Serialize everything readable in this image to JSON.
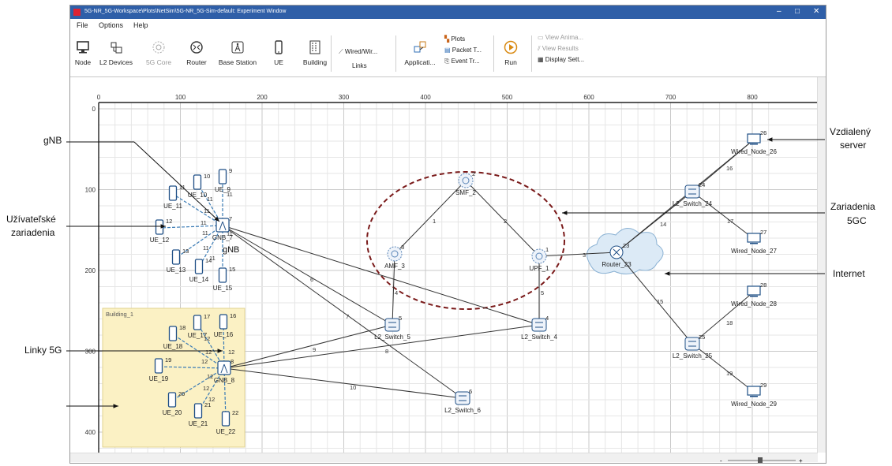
{
  "window": {
    "title": "5G-NR_5G-Workspace\\Plots\\NetSim\\5G-NR_5G-Sim-default: Experiment Window",
    "min_icon": "minimize-icon",
    "max_icon": "maximize-icon",
    "close_icon": "close-icon"
  },
  "menu": {
    "file": "File",
    "options": "Options",
    "help": "Help"
  },
  "toolbar": {
    "node": "Node",
    "l2": "L2 Devices",
    "core": "5G Core",
    "router": "Router",
    "bs": "Base Station",
    "ue": "UE",
    "building": "Building",
    "wired": "Wired/Wir...",
    "links": "Links",
    "app": "Applicati...",
    "plots": "Plots",
    "packet": "Packet T...",
    "event": "Event Tr...",
    "run": "Run",
    "view_anim": "View Anima...",
    "view_results": "View Results",
    "display": "Display Sett..."
  },
  "canvas": {
    "xticks": [
      "0",
      "100",
      "200",
      "300",
      "400",
      "500",
      "600",
      "700",
      "800"
    ],
    "yticks": [
      "0",
      "100",
      "200",
      "300",
      "400"
    ],
    "building_label": "Building_1",
    "nodes": [
      {
        "label": "UE_9",
        "num": "9"
      },
      {
        "label": "UE_10",
        "num": "10"
      },
      {
        "label": "UE_11",
        "num": "11"
      },
      {
        "label": "UE_12",
        "num": "12"
      },
      {
        "label": "UE_13",
        "num": "13"
      },
      {
        "label": "UE_14",
        "num": "14"
      },
      {
        "label": "UE_15",
        "num": "15"
      },
      {
        "label": "GNB_7",
        "num": "7"
      },
      {
        "label": "GNB_8",
        "num": "8"
      },
      {
        "label": "UE_16",
        "num": "16"
      },
      {
        "label": "UE_17",
        "num": "17"
      },
      {
        "label": "UE_18",
        "num": "18"
      },
      {
        "label": "UE_19",
        "num": "19"
      },
      {
        "label": "UE_20",
        "num": "20"
      },
      {
        "label": "UE_21",
        "num": "21"
      },
      {
        "label": "UE_22",
        "num": "22"
      },
      {
        "label": "SMF_2",
        "num": "2"
      },
      {
        "label": "AMF_3",
        "num": "3"
      },
      {
        "label": "UPF_1",
        "num": "1"
      },
      {
        "label": "L2_Switch_5",
        "num": "5"
      },
      {
        "label": "L2_Switch_4",
        "num": "4"
      },
      {
        "label": "L2_Switch_6",
        "num": "6"
      },
      {
        "label": "Router_23",
        "num": "23"
      },
      {
        "label": "L2_Switch_24",
        "num": "24"
      },
      {
        "label": "L2_Switch_25",
        "num": "25"
      },
      {
        "label": "Wired_Node_26",
        "num": "26"
      },
      {
        "label": "Wired_Node_27",
        "num": "27"
      },
      {
        "label": "Wired_Node_28",
        "num": "28"
      },
      {
        "label": "Wired_Node_29",
        "num": "29"
      }
    ],
    "link_labels": [
      "1",
      "2",
      "3",
      "4",
      "5",
      "6",
      "7",
      "8",
      "9",
      "10",
      "11",
      "11",
      "11",
      "11",
      "11",
      "11",
      "11",
      "11",
      "12",
      "12",
      "12",
      "12",
      "12",
      "12",
      "12",
      "14",
      "15",
      "16",
      "17",
      "18",
      "19"
    ],
    "gnb_overlay": "gNB"
  },
  "annotations": {
    "gnb": "gNB",
    "ue_line1": "Užívateľské",
    "ue_line2": "zariadenia",
    "links5g": "Linky 5G",
    "remote_line1": "Vzdialený",
    "remote_line2": "server",
    "core_line1": "Zariadenia",
    "core_line2": "5GC",
    "internet": "Internet"
  },
  "colors": {
    "titlebar": "#2f5fa8",
    "building": "#fbf1c4",
    "core_circle": "#7a1a1a",
    "wireless_link": "#3a7bb5"
  }
}
